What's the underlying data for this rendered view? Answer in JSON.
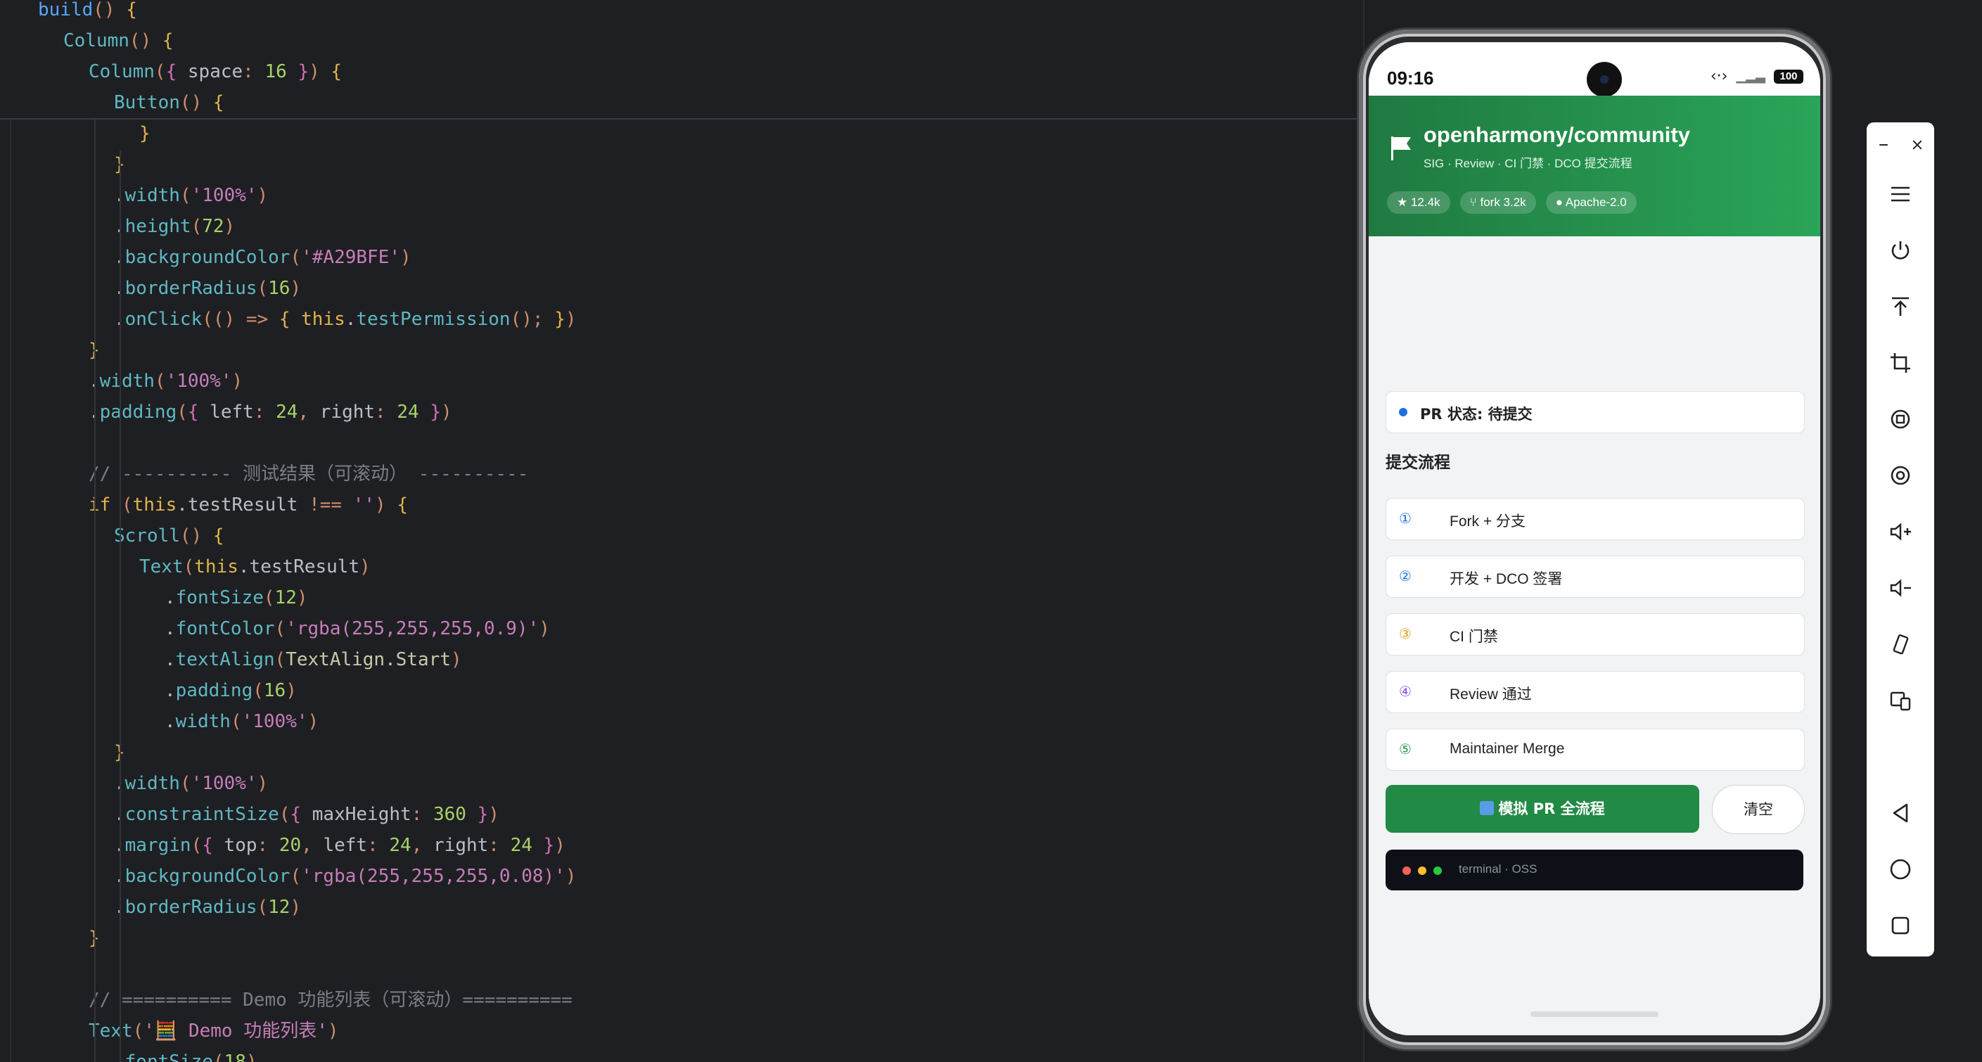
{
  "editor": {
    "lines": [
      {
        "indent": 1,
        "tokens": [
          [
            "fn",
            "build"
          ],
          [
            "kw",
            "() "
          ],
          [
            "pr1",
            "{"
          ]
        ]
      },
      {
        "indent": 2,
        "tokens": [
          [
            "mem",
            "Column"
          ],
          [
            "kw",
            "() "
          ],
          [
            "pr1",
            "{"
          ]
        ]
      },
      {
        "indent": 3,
        "tokens": [
          [
            "mem",
            "Column"
          ],
          [
            "kw",
            "("
          ],
          [
            "pr2",
            "{ "
          ],
          [
            "tx",
            "space"
          ],
          [
            "kw",
            ": "
          ],
          [
            "num2",
            "16"
          ],
          [
            "pr2",
            " }"
          ],
          [
            "kw",
            ") "
          ],
          [
            "pr1",
            "{"
          ]
        ]
      },
      {
        "indent": 4,
        "tokens": [
          [
            "mem",
            "Button"
          ],
          [
            "kw",
            "() "
          ],
          [
            "pr1",
            "{"
          ]
        ]
      },
      {
        "indent": 5,
        "tokens": [
          [
            "pr1",
            "}"
          ]
        ]
      },
      {
        "indent": 4,
        "tokens": [
          [
            "pr1",
            "}"
          ]
        ]
      },
      {
        "indent": 4,
        "tokens": [
          [
            "tx",
            "."
          ],
          [
            "mem",
            "width"
          ],
          [
            "kw",
            "("
          ],
          [
            "strp",
            "'100%'"
          ],
          [
            "kw",
            ")"
          ]
        ]
      },
      {
        "indent": 4,
        "tokens": [
          [
            "tx",
            "."
          ],
          [
            "mem",
            "height"
          ],
          [
            "kw",
            "("
          ],
          [
            "num2",
            "72"
          ],
          [
            "kw",
            ")"
          ]
        ]
      },
      {
        "indent": 4,
        "tokens": [
          [
            "tx",
            "."
          ],
          [
            "mem",
            "backgroundColor"
          ],
          [
            "kw",
            "("
          ],
          [
            "strp",
            "'#A29BFE'"
          ],
          [
            "kw",
            ")"
          ]
        ]
      },
      {
        "indent": 4,
        "tokens": [
          [
            "tx",
            "."
          ],
          [
            "mem",
            "borderRadius"
          ],
          [
            "kw",
            "("
          ],
          [
            "num2",
            "16"
          ],
          [
            "kw",
            ")"
          ]
        ]
      },
      {
        "indent": 4,
        "tokens": [
          [
            "tx",
            "."
          ],
          [
            "mem",
            "onClick"
          ],
          [
            "kw",
            "(("
          ],
          [
            "kw",
            ") => "
          ],
          [
            "pr1",
            "{ "
          ],
          [
            "pr1",
            "this"
          ],
          [
            "tx",
            "."
          ],
          [
            "mem",
            "testPermission"
          ],
          [
            "kw",
            "(); "
          ],
          [
            "pr1",
            "}"
          ],
          [
            "kw",
            ")"
          ]
        ]
      },
      {
        "indent": 3,
        "tokens": [
          [
            "pr1",
            "}"
          ]
        ]
      },
      {
        "indent": 3,
        "tokens": [
          [
            "tx",
            "."
          ],
          [
            "mem",
            "width"
          ],
          [
            "kw",
            "("
          ],
          [
            "strp",
            "'100%'"
          ],
          [
            "kw",
            ")"
          ]
        ]
      },
      {
        "indent": 3,
        "tokens": [
          [
            "tx",
            "."
          ],
          [
            "mem",
            "padding"
          ],
          [
            "kw",
            "("
          ],
          [
            "pr2",
            "{ "
          ],
          [
            "tx",
            "left"
          ],
          [
            "kw",
            ": "
          ],
          [
            "num2",
            "24"
          ],
          [
            "kw",
            ", "
          ],
          [
            "tx",
            "right"
          ],
          [
            "kw",
            ": "
          ],
          [
            "num2",
            "24"
          ],
          [
            "pr2",
            " }"
          ],
          [
            "kw",
            ")"
          ]
        ]
      },
      {
        "indent": 0,
        "tokens": []
      },
      {
        "indent": 3,
        "tokens": [
          [
            "cm",
            "// ---------- 测试结果（可滚动） ----------"
          ]
        ]
      },
      {
        "indent": 3,
        "tokens": [
          [
            "pr1",
            "if "
          ],
          [
            "kw",
            "("
          ],
          [
            "pr1",
            "this"
          ],
          [
            "tx",
            ".testResult "
          ],
          [
            "kw",
            "!== "
          ],
          [
            "strp",
            "''"
          ],
          [
            "kw",
            ") "
          ],
          [
            "pr1",
            "{"
          ]
        ]
      },
      {
        "indent": 4,
        "tokens": [
          [
            "mem",
            "Scroll"
          ],
          [
            "kw",
            "() "
          ],
          [
            "pr1",
            "{"
          ]
        ]
      },
      {
        "indent": 5,
        "tokens": [
          [
            "mem",
            "Text"
          ],
          [
            "kw",
            "("
          ],
          [
            "pr1",
            "this"
          ],
          [
            "tx",
            ".testResult"
          ],
          [
            "kw",
            ")"
          ]
        ]
      },
      {
        "indent": 6,
        "tokens": [
          [
            "tx",
            "."
          ],
          [
            "mem",
            "fontSize"
          ],
          [
            "kw",
            "("
          ],
          [
            "num2",
            "12"
          ],
          [
            "kw",
            ")"
          ]
        ]
      },
      {
        "indent": 6,
        "tokens": [
          [
            "tx",
            "."
          ],
          [
            "mem",
            "fontColor"
          ],
          [
            "kw",
            "("
          ],
          [
            "strp",
            "'rgba(255,255,255,0.9)'"
          ],
          [
            "kw",
            ")"
          ]
        ]
      },
      {
        "indent": 6,
        "tokens": [
          [
            "tx",
            "."
          ],
          [
            "mem",
            "textAlign"
          ],
          [
            "kw",
            "("
          ],
          [
            "ty",
            "TextAlign.Start"
          ],
          [
            "kw",
            ")"
          ]
        ]
      },
      {
        "indent": 6,
        "tokens": [
          [
            "tx",
            "."
          ],
          [
            "mem",
            "padding"
          ],
          [
            "kw",
            "("
          ],
          [
            "num2",
            "16"
          ],
          [
            "kw",
            ")"
          ]
        ]
      },
      {
        "indent": 6,
        "tokens": [
          [
            "tx",
            "."
          ],
          [
            "mem",
            "width"
          ],
          [
            "kw",
            "("
          ],
          [
            "strp",
            "'100%'"
          ],
          [
            "kw",
            ")"
          ]
        ]
      },
      {
        "indent": 4,
        "tokens": [
          [
            "pr1",
            "}"
          ]
        ]
      },
      {
        "indent": 4,
        "tokens": [
          [
            "tx",
            "."
          ],
          [
            "mem",
            "width"
          ],
          [
            "kw",
            "("
          ],
          [
            "strp",
            "'100%'"
          ],
          [
            "kw",
            ")"
          ]
        ]
      },
      {
        "indent": 4,
        "tokens": [
          [
            "tx",
            "."
          ],
          [
            "mem",
            "constraintSize"
          ],
          [
            "kw",
            "("
          ],
          [
            "pr2",
            "{ "
          ],
          [
            "tx",
            "maxHeight"
          ],
          [
            "kw",
            ": "
          ],
          [
            "num2",
            "360"
          ],
          [
            "pr2",
            " }"
          ],
          [
            "kw",
            ")"
          ]
        ]
      },
      {
        "indent": 4,
        "tokens": [
          [
            "tx",
            "."
          ],
          [
            "mem",
            "margin"
          ],
          [
            "kw",
            "("
          ],
          [
            "pr2",
            "{ "
          ],
          [
            "tx",
            "top"
          ],
          [
            "kw",
            ": "
          ],
          [
            "num2",
            "20"
          ],
          [
            "kw",
            ", "
          ],
          [
            "tx",
            "left"
          ],
          [
            "kw",
            ": "
          ],
          [
            "num2",
            "24"
          ],
          [
            "kw",
            ", "
          ],
          [
            "tx",
            "right"
          ],
          [
            "kw",
            ": "
          ],
          [
            "num2",
            "24"
          ],
          [
            "pr2",
            " }"
          ],
          [
            "kw",
            ")"
          ]
        ]
      },
      {
        "indent": 4,
        "tokens": [
          [
            "tx",
            "."
          ],
          [
            "mem",
            "backgroundColor"
          ],
          [
            "kw",
            "("
          ],
          [
            "strp",
            "'rgba(255,255,255,0.08)'"
          ],
          [
            "kw",
            ")"
          ]
        ]
      },
      {
        "indent": 4,
        "tokens": [
          [
            "tx",
            "."
          ],
          [
            "mem",
            "borderRadius"
          ],
          [
            "kw",
            "("
          ],
          [
            "num2",
            "12"
          ],
          [
            "kw",
            ")"
          ]
        ]
      },
      {
        "indent": 3,
        "tokens": [
          [
            "pr1",
            "}"
          ]
        ]
      },
      {
        "indent": 0,
        "tokens": []
      },
      {
        "indent": 3,
        "tokens": [
          [
            "cm",
            "// ========== Demo 功能列表（可滚动）=========="
          ]
        ]
      },
      {
        "indent": 3,
        "tokens": [
          [
            "mem",
            "Text"
          ],
          [
            "kw",
            "("
          ],
          [
            "strp",
            "'🧮 Demo 功能列表'"
          ],
          [
            "kw",
            ")"
          ]
        ]
      },
      {
        "indent": 4,
        "tokens": [
          [
            "tx",
            "."
          ],
          [
            "mem",
            "fontSize"
          ],
          [
            "kw",
            "("
          ],
          [
            "num2",
            "18"
          ],
          [
            "kw",
            ")"
          ]
        ]
      }
    ]
  },
  "phone": {
    "status": {
      "time": "09:16",
      "battery": "100"
    },
    "header": {
      "title": "openharmony/community",
      "subtitle": "SIG · Review · CI 门禁 · DCO 提交流程",
      "badges": [
        "★ 12.4k",
        "⑂ fork 3.2k",
        "● Apache-2.0"
      ]
    },
    "pr_status": "PR 状态: 待提交",
    "section_title": "提交流程",
    "steps": [
      {
        "num": "①",
        "label": "Fork + 分支",
        "color": "#1d6fe0"
      },
      {
        "num": "②",
        "label": "开发 + DCO 签署",
        "color": "#1d6fe0"
      },
      {
        "num": "③",
        "label": "CI 门禁",
        "color": "#e0a21d"
      },
      {
        "num": "④",
        "label": "Review 通过",
        "color": "#8a4fe0"
      },
      {
        "num": "⑤",
        "label": "Maintainer Merge",
        "color": "#2a9a4a"
      }
    ],
    "run_button": "模拟 PR 全流程",
    "clear_button": "清空",
    "terminal_label": "terminal · OSS",
    "terminal_dots": [
      "#ff5f56",
      "#ffbd2e",
      "#27c93f"
    ]
  },
  "colors": {
    "header_start": "#1f7a41",
    "header_end": "#2aa558",
    "primary": "#218a45"
  },
  "toolbar_icons": [
    "minimize-icon",
    "close-icon",
    "menu-icon",
    "power-icon",
    "upload-icon",
    "crop-icon",
    "rotate-icon",
    "screen-record-icon",
    "volume-up-icon",
    "volume-down-icon",
    "rotate-device-icon",
    "multi-device-icon",
    "back-icon",
    "home-icon",
    "recents-icon"
  ]
}
